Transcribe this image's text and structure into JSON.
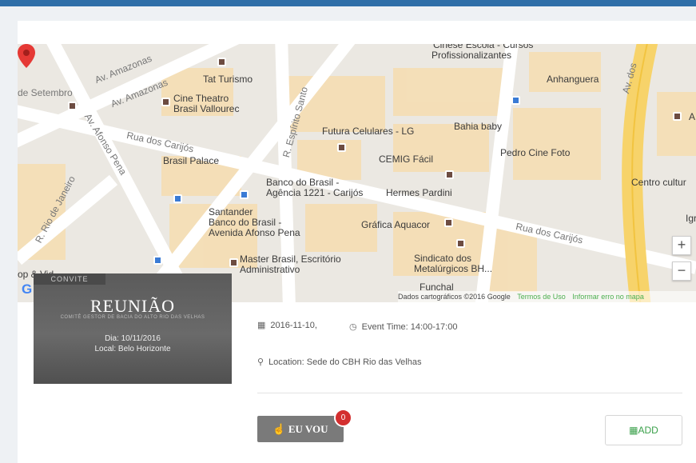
{
  "map": {
    "streets": [
      "Av. Amazonas",
      "Av. Amazonas",
      "Av. Afonso Pena",
      "Rua dos Carijós",
      "Rua dos Carijós",
      "R. Espírito Santo",
      "R. Rio de Janeiro",
      "Av. dos",
      "de Setembro"
    ],
    "places": [
      "Tat Turismo",
      "Cine Theatro",
      "Brasil Vallourec",
      "Brasil Palace",
      "Futura Celulares - LG",
      "Bahia baby",
      "Anhanguera",
      "Profissionalizantes",
      "CEMIG Fácil",
      "Pedro Cine Foto",
      "Banco do Brasil -",
      "Agência 1221 - Carijós",
      "Hermes Pardini",
      "Centro cultur",
      "Santander",
      "Banco do Brasil -",
      "Avenida Afonso Pena",
      "Gráfica Aquacor",
      "Master Brasil, Escritório",
      "Administrativo",
      "Sindicato dos",
      "Metalúrgicos BH...",
      "Funchal",
      "Igr",
      "Cinese Escola - Cursos",
      "A",
      "op & Vid"
    ],
    "zoom_in": "+",
    "zoom_out": "−",
    "google_logo": "G",
    "attribution": "Dados cartográficos ©2016 Google",
    "terms": "Termos de Uso",
    "report": "Informar erro no mapa",
    "marker_icon": "map-pin-icon",
    "marker_color": "#e53935"
  },
  "invite": {
    "tag": "CONVITE",
    "title": "REUNIÃO",
    "subtitle": "COMITÊ GESTOR DE BACIA DO ALTO RIO DAS VELHAS",
    "date": "Dia: 10/11/2016",
    "local": "Local: Belo Horizonte"
  },
  "event": {
    "date": "2016-11-10,",
    "time": "Event Time: 14:00-17:00",
    "location_label": "Location:",
    "location_value": " Sede do CBH Rio das Velhas",
    "calendar_icon": "calendar-icon",
    "clock_icon": "clock-icon",
    "pin_icon": "location-pin-icon"
  },
  "actions": {
    "going_label": "EU VOU",
    "going_count": "0",
    "add_label": "ADD",
    "thumb_icon": "thumbs-up-icon",
    "add_icon": "calendar-add-icon"
  },
  "colors": {
    "topbar": "#2f6fa8",
    "badge": "#d32f2f",
    "add_text": "#3aa04a",
    "button_gray": "#7a7a7a"
  }
}
